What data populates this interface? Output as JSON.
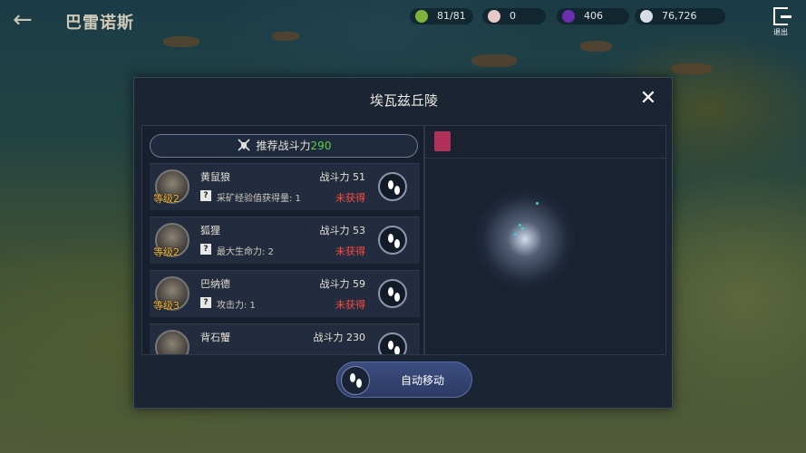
{
  "region_title": "巴雷诺斯",
  "resources": [
    {
      "icon": "stamina-icon",
      "value": "81/81",
      "color": "#7fb23a"
    },
    {
      "icon": "pearl-icon",
      "value": "0",
      "color": "#e7c9c9"
    },
    {
      "icon": "dark-gem-icon",
      "value": "406",
      "color": "#6a2fb0"
    },
    {
      "icon": "silver-coin-icon",
      "value": "76,726",
      "color": "#d6dde6"
    }
  ],
  "exit_label": "退出",
  "modal": {
    "title": "埃瓦兹丘陵",
    "recommend_label": "推荐战斗力",
    "recommend_value": "290",
    "monsters": [
      {
        "level": "等级2",
        "name": "黄鼠狼",
        "power": "战斗力 51",
        "reward": "采矿经验值获得量: 1",
        "status": "未获得"
      },
      {
        "level": "等级2",
        "name": "狐狸",
        "power": "战斗力 53",
        "reward": "最大生命力: 2",
        "status": "未获得"
      },
      {
        "level": "等级3",
        "name": "巴纳德",
        "power": "战斗力 59",
        "reward": "攻击力: 1",
        "status": "未获得"
      },
      {
        "level": "",
        "name": "背石蟹",
        "power": "战斗力 230",
        "reward": "",
        "status": ""
      }
    ],
    "auto_move_label": "自动移动"
  }
}
